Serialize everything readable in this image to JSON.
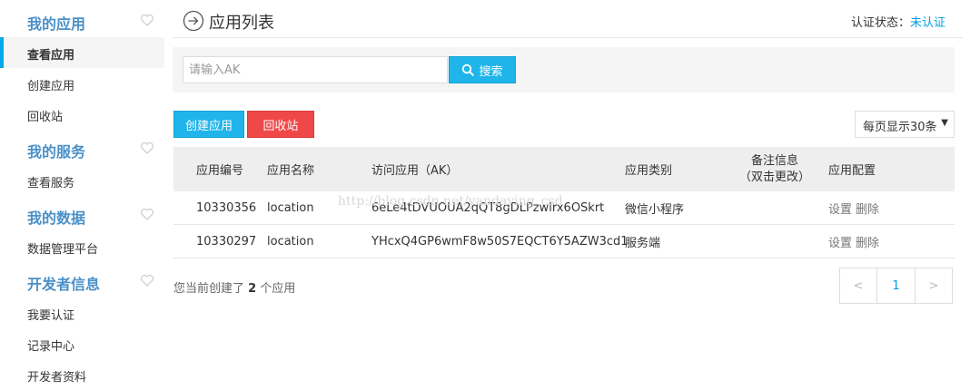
{
  "sidebar": {
    "sections": [
      {
        "title": "我的应用",
        "items": [
          {
            "label": "查看应用",
            "active": true
          },
          {
            "label": "创建应用"
          },
          {
            "label": "回收站"
          }
        ]
      },
      {
        "title": "我的服务",
        "items": [
          {
            "label": "查看服务"
          }
        ]
      },
      {
        "title": "我的数据",
        "items": [
          {
            "label": "数据管理平台"
          }
        ]
      },
      {
        "title": "开发者信息",
        "items": [
          {
            "label": "我要认证"
          },
          {
            "label": "记录中心"
          },
          {
            "label": "开发者资料"
          }
        ]
      }
    ],
    "icon": "heart-outline-icon"
  },
  "header": {
    "icon": "circle-arrow-right-icon",
    "title": "应用列表",
    "auth_label": "认证状态：",
    "auth_value": "未认证"
  },
  "search": {
    "placeholder": "请输入AK",
    "value": "",
    "button_label": "搜索",
    "button_icon": "search-icon"
  },
  "actions": {
    "create_label": "创建应用",
    "recycle_label": "回收站",
    "per_page": "每页显示30条"
  },
  "table": {
    "headers": {
      "id": "应用编号",
      "name": "应用名称",
      "ak": "访问应用（AK）",
      "type": "应用类别",
      "note_line1": "备注信息",
      "note_line2": "（双击更改）",
      "config": "应用配置"
    },
    "rows": [
      {
        "id": "10330356",
        "name": "location",
        "ak": "6eLe4tDVUOUA2qQT8gDLPzwlrx6OSkrt",
        "type": "微信小程序",
        "note": "",
        "settings": "设置",
        "delete": "删除"
      },
      {
        "id": "10330297",
        "name": "location",
        "ak": "YHcxQ4GP6wmF8w50S7EQCT6Y5AZW3cd1",
        "type": "服务端",
        "note": "",
        "settings": "设置",
        "delete": "删除"
      }
    ]
  },
  "footer": {
    "prefix": "您当前创建了",
    "count": "2",
    "suffix": "个应用"
  },
  "pagination": {
    "prev": "<",
    "current": "1",
    "next": ">"
  },
  "watermark": "http://blog.csdn.net/yandaying_csd",
  "colors": {
    "primary": "#1fb5ea",
    "danger": "#f04848",
    "link": "#00a0e9",
    "sidebar_title": "#4a90c8"
  }
}
